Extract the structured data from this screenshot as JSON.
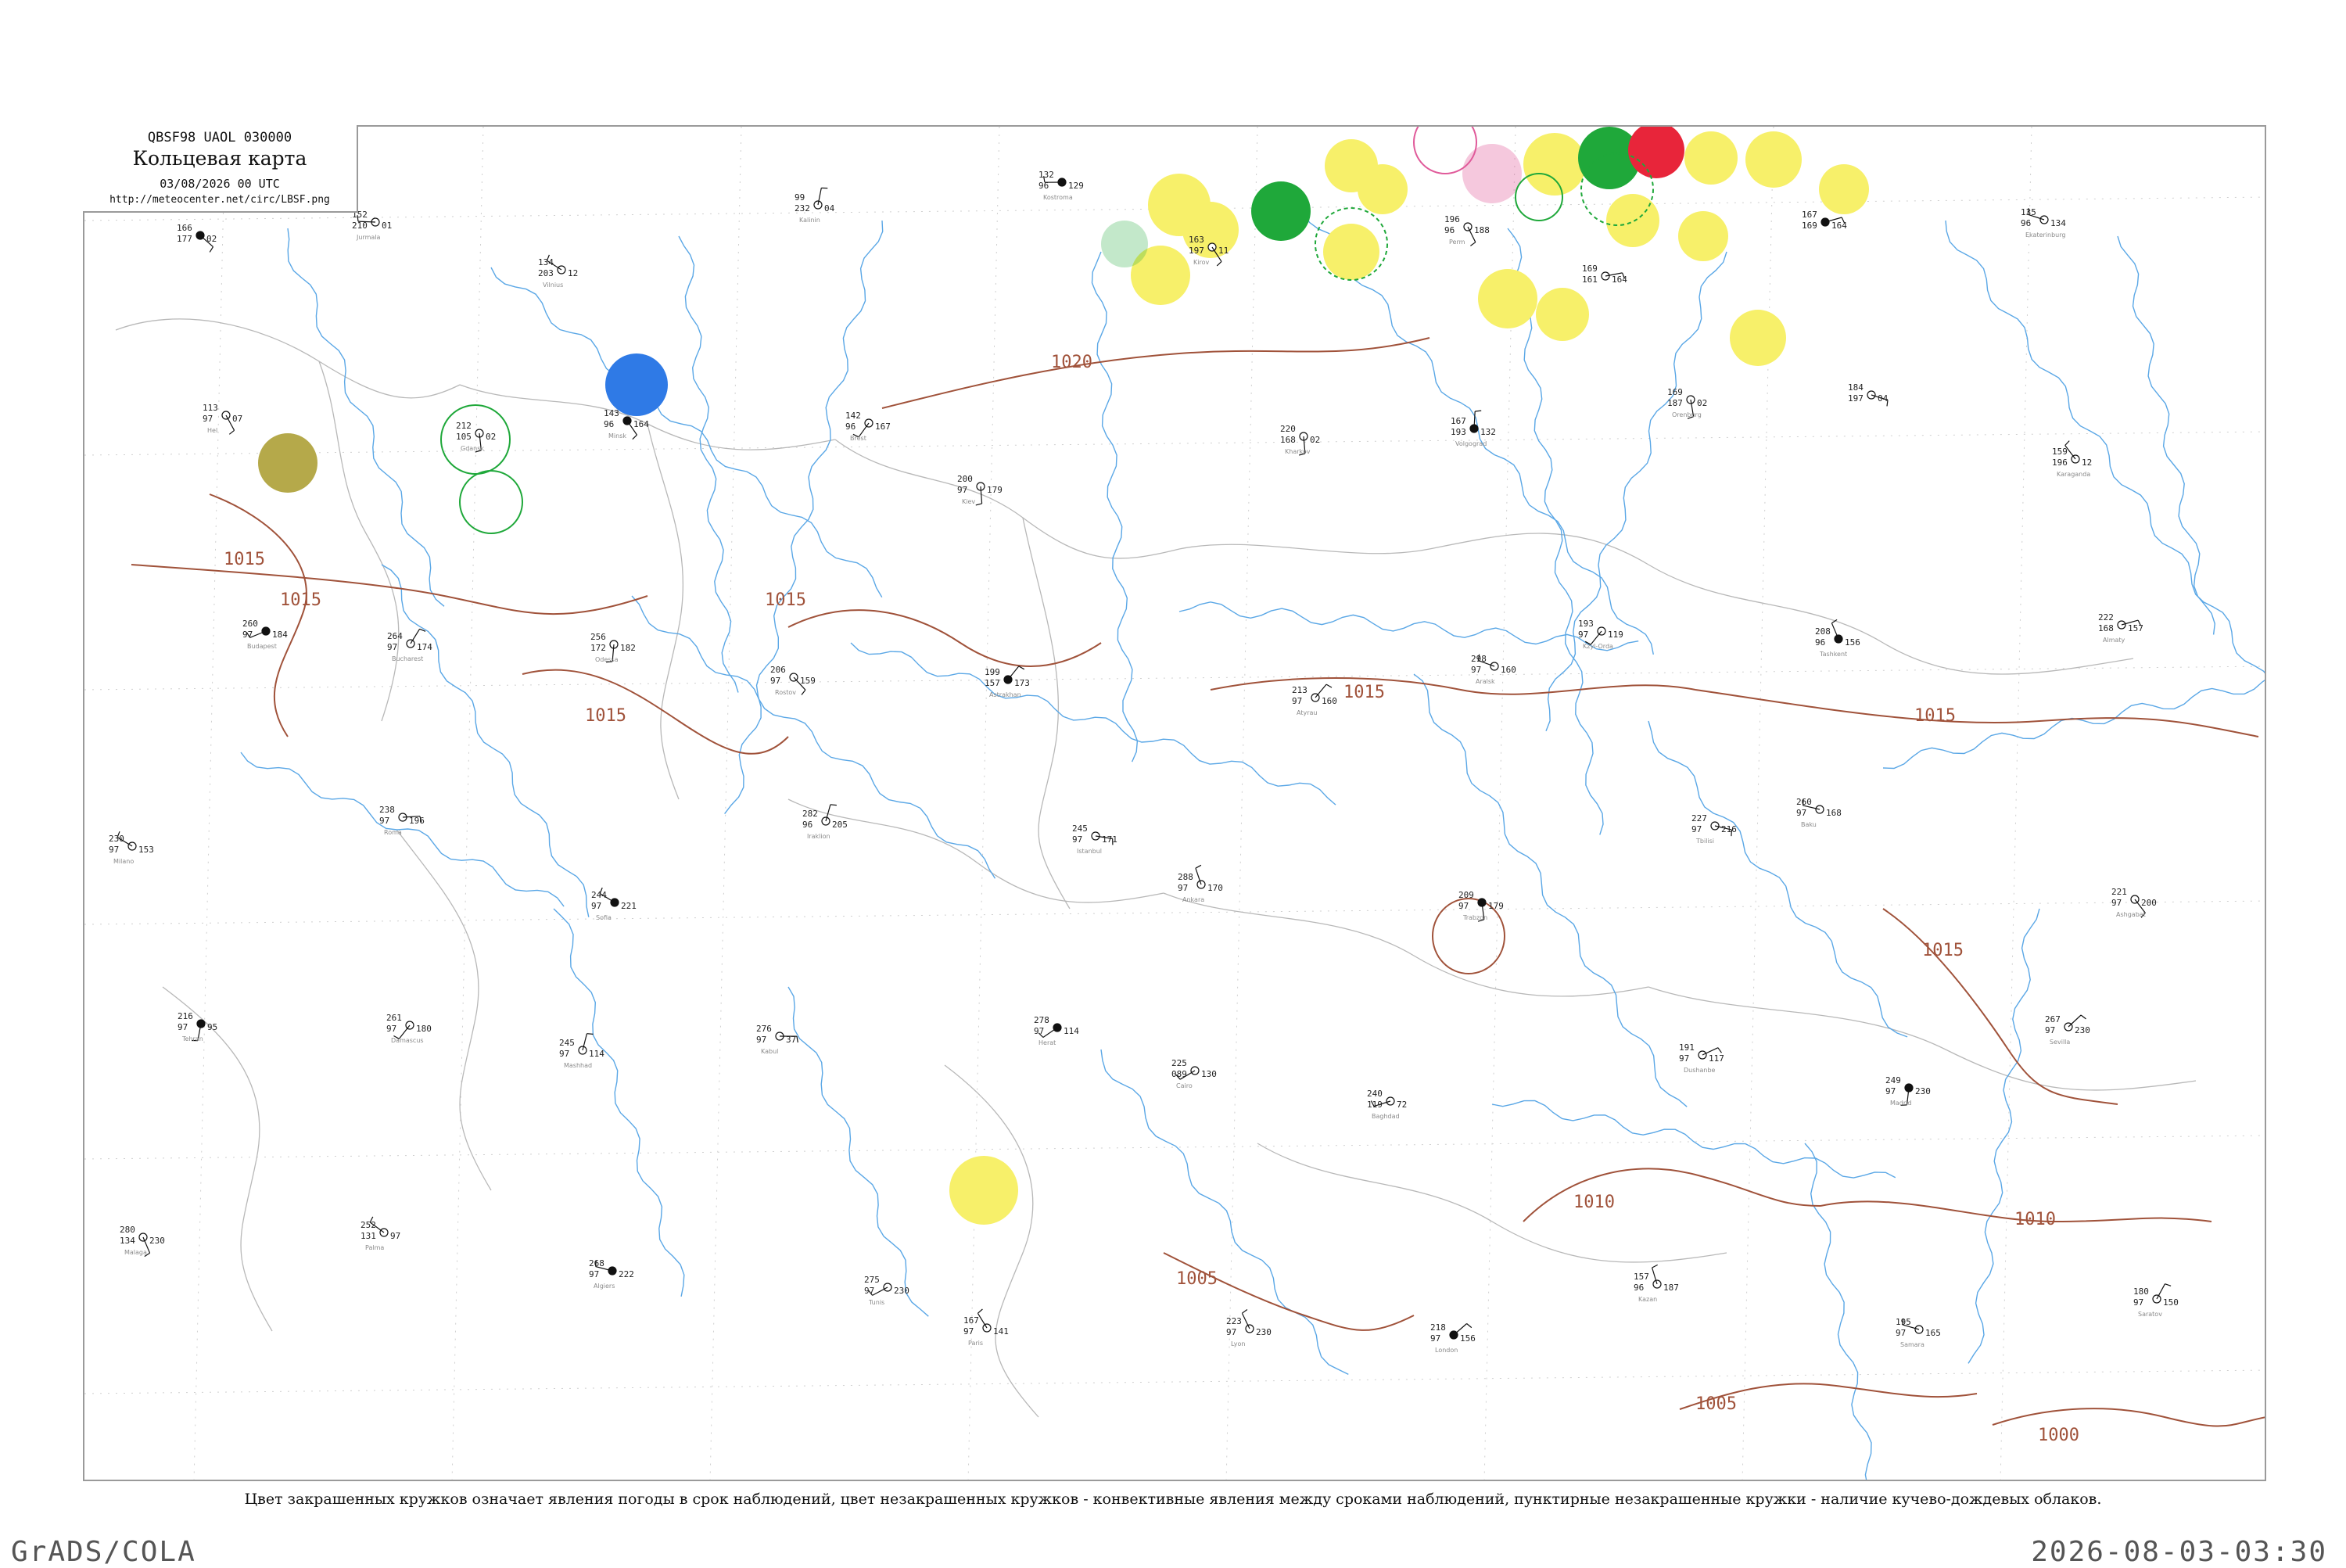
{
  "header": {
    "code_line": "QBSF98  UAOL  030000",
    "title": "Кольцевая карта",
    "date_line": "03/08/2026 00 UTC",
    "url": "http://meteocenter.net/circ/LBSF.png"
  },
  "caption": "Цвет закрашенных кружков означает явления погоды в срок наблюдений, цвет незакрашенных кружков - конвективные явления между сроками наблюдений, пунктирные незакрашенные кружки - наличие кучево-дождевых облаков.",
  "footer": {
    "left": "GrADS/COLA",
    "right": "2026-08-03-03:30"
  },
  "colors": {
    "frame": "#9a9a9a",
    "isobar": "#a0523a",
    "river": "#5aa7e6",
    "border": "#b8b8b8",
    "yellow_marker": "#f7f06a",
    "green_marker": "#1fa83a",
    "red_marker": "#e8253a",
    "blue_marker": "#2f7ae6",
    "olive_marker": "#b5a94a",
    "pink_circle": "#e05a9a"
  },
  "isobars": [
    {
      "label": "1015"
    },
    {
      "label": "1015"
    },
    {
      "label": "1015"
    },
    {
      "label": "1015"
    },
    {
      "label": "1020"
    },
    {
      "label": "1015"
    },
    {
      "label": "1015"
    },
    {
      "label": "1015"
    },
    {
      "label": "1010"
    },
    {
      "label": "1010"
    },
    {
      "label": "1005"
    },
    {
      "label": "1005"
    },
    {
      "label": "1000"
    }
  ],
  "stations": [
    {
      "temp": "166",
      "dew": "177",
      "pres": "02",
      "name": ""
    },
    {
      "temp": "152",
      "dew": "210",
      "pres": "01",
      "name": "Jurmala"
    },
    {
      "temp": "134",
      "dew": "203",
      "pres": "12",
      "name": "Vilnius"
    },
    {
      "temp": "99",
      "dew": "232",
      "pres": "04",
      "name": "Kalinin"
    },
    {
      "temp": "132",
      "dew": "96",
      "pres": "129",
      "name": "Kostroma"
    },
    {
      "temp": "163",
      "dew": "197",
      "pres": "11",
      "name": "Kirov"
    },
    {
      "temp": "196",
      "dew": "96",
      "pres": "188",
      "name": "Perm"
    },
    {
      "temp": "169",
      "dew": "161",
      "pres": "164",
      "name": ""
    },
    {
      "temp": "167",
      "dew": "169",
      "pres": "164",
      "name": ""
    },
    {
      "temp": "135",
      "dew": "96",
      "pres": "134",
      "name": "Ekaterinburg"
    },
    {
      "temp": "113",
      "dew": "97",
      "pres": "07",
      "name": "Hel"
    },
    {
      "temp": "212",
      "dew": "105",
      "pres": "02",
      "name": "Gdansk"
    },
    {
      "temp": "143",
      "dew": "96",
      "pres": "164",
      "name": "Minsk"
    },
    {
      "temp": "142",
      "dew": "96",
      "pres": "167",
      "name": "Brest"
    },
    {
      "temp": "200",
      "dew": "97",
      "pres": "179",
      "name": "Kiev"
    },
    {
      "temp": "220",
      "dew": "168",
      "pres": "02",
      "name": "Kharkov"
    },
    {
      "temp": "167",
      "dew": "193",
      "pres": "132",
      "name": "Volgograd"
    },
    {
      "temp": "169",
      "dew": "187",
      "pres": "02",
      "name": "Orenburg"
    },
    {
      "temp": "184",
      "dew": "197",
      "pres": "04",
      "name": ""
    },
    {
      "temp": "159",
      "dew": "196",
      "pres": "12",
      "name": "Karaganda"
    },
    {
      "temp": "260",
      "dew": "97",
      "pres": "184",
      "name": "Budapest"
    },
    {
      "temp": "264",
      "dew": "97",
      "pres": "174",
      "name": "Bucharest"
    },
    {
      "temp": "256",
      "dew": "172",
      "pres": "182",
      "name": "Odessa"
    },
    {
      "temp": "206",
      "dew": "97",
      "pres": "159",
      "name": "Rostov"
    },
    {
      "temp": "199",
      "dew": "157",
      "pres": "173",
      "name": "Astrakhan"
    },
    {
      "temp": "213",
      "dew": "97",
      "pres": "160",
      "name": "Atyrau"
    },
    {
      "temp": "298",
      "dew": "97",
      "pres": "160",
      "name": "Aralsk"
    },
    {
      "temp": "193",
      "dew": "97",
      "pres": "119",
      "name": "Kzyl-Orda"
    },
    {
      "temp": "208",
      "dew": "96",
      "pres": "156",
      "name": "Tashkent"
    },
    {
      "temp": "222",
      "dew": "168",
      "pres": "157",
      "name": "Almaty"
    },
    {
      "temp": "230",
      "dew": "97",
      "pres": "153",
      "name": "Milano"
    },
    {
      "temp": "238",
      "dew": "97",
      "pres": "196",
      "name": "Roma"
    },
    {
      "temp": "244",
      "dew": "97",
      "pres": "221",
      "name": "Sofia"
    },
    {
      "temp": "282",
      "dew": "96",
      "pres": "205",
      "name": "Iraklion"
    },
    {
      "temp": "245",
      "dew": "97",
      "pres": "171",
      "name": "Istanbul"
    },
    {
      "temp": "288",
      "dew": "97",
      "pres": "170",
      "name": "Ankara"
    },
    {
      "temp": "209",
      "dew": "97",
      "pres": "179",
      "name": "Trabzon"
    },
    {
      "temp": "227",
      "dew": "97",
      "pres": "216",
      "name": "Tbilisi"
    },
    {
      "temp": "260",
      "dew": "97",
      "pres": "168",
      "name": "Baku"
    },
    {
      "temp": "221",
      "dew": "97",
      "pres": "200",
      "name": "Ashgabat"
    },
    {
      "temp": "216",
      "dew": "97",
      "pres": "95",
      "name": "Tehran"
    },
    {
      "temp": "261",
      "dew": "97",
      "pres": "180",
      "name": "Damascus"
    },
    {
      "temp": "245",
      "dew": "97",
      "pres": "114",
      "name": "Mashhad"
    },
    {
      "temp": "276",
      "dew": "97",
      "pres": "37",
      "name": "Kabul"
    },
    {
      "temp": "278",
      "dew": "97",
      "pres": "114",
      "name": "Herat"
    },
    {
      "temp": "225",
      "dew": "089",
      "pres": "130",
      "name": "Cairo"
    },
    {
      "temp": "240",
      "dew": "119",
      "pres": "72",
      "name": "Baghdad"
    },
    {
      "temp": "191",
      "dew": "97",
      "pres": "117",
      "name": "Dushanbe"
    },
    {
      "temp": "249",
      "dew": "97",
      "pres": "230",
      "name": "Madrid"
    },
    {
      "temp": "267",
      "dew": "97",
      "pres": "230",
      "name": "Sevilla"
    },
    {
      "temp": "280",
      "dew": "134",
      "pres": "230",
      "name": "Malaga"
    },
    {
      "temp": "252",
      "dew": "131",
      "pres": "97",
      "name": "Palma"
    },
    {
      "temp": "268",
      "dew": "97",
      "pres": "222",
      "name": "Algiers"
    },
    {
      "temp": "275",
      "dew": "97",
      "pres": "230",
      "name": "Tunis"
    },
    {
      "temp": "167",
      "dew": "97",
      "pres": "141",
      "name": "Paris"
    },
    {
      "temp": "223",
      "dew": "97",
      "pres": "230",
      "name": "Lyon"
    },
    {
      "temp": "218",
      "dew": "97",
      "pres": "156",
      "name": "London"
    },
    {
      "temp": "157",
      "dew": "96",
      "pres": "187",
      "name": "Kazan"
    },
    {
      "temp": "195",
      "dew": "97",
      "pres": "165",
      "name": "Samara"
    },
    {
      "temp": "180",
      "dew": "97",
      "pres": "150",
      "name": "Saratov"
    }
  ]
}
